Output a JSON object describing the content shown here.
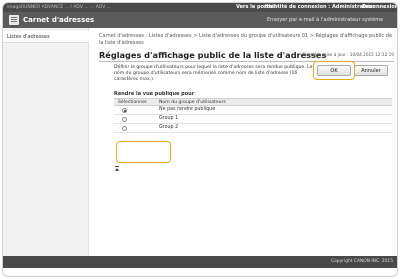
{
  "topbar": {
    "device": "imageRUNNER ADVANCE ... / ADV ...   ... ADV ...",
    "portal_link": "Vers le portail",
    "login_text": "Identité de connexion : Administrateur",
    "logout_link": "Déconnexion"
  },
  "titlebar": {
    "title": "Carnet d'adresses",
    "send_link": "Envoyer par e-mail à l'administrateur système"
  },
  "sidebar": {
    "items": [
      {
        "label": "Listes d'adresses"
      }
    ]
  },
  "main": {
    "breadcrumb": "Carnet d'adresses : Listes d'adresses > Liste d'adresses du groupe d'utilisateurs 01 > Réglages d'affichage public de la liste d'adresses",
    "title": "Réglages d'affichage public de la liste d'adresses",
    "updated": "Dernière mise à jour : 10/04 2015 12:12:19",
    "description": "Définir le groupe d'utilisateurs pour lequel la liste d'adresses sera rendue publique. Le nom du groupe d'utilisateurs sera mémorisé comme nom de liste d'adresse (16 caractères max.).",
    "ok_label": "OK",
    "cancel_label": "Annuler",
    "section_title": "Rendre la vue publique pour",
    "table": {
      "headers": [
        "Sélectionner",
        "Nom du groupe d'utilisateurs"
      ],
      "rows": [
        {
          "label": "Ne pas rendre publique",
          "selected": true
        },
        {
          "label": "Group 1",
          "selected": false
        },
        {
          "label": "Group 2",
          "selected": false
        }
      ]
    }
  },
  "footer": {
    "copyright": "Copyright CANON INC. 2015"
  },
  "colors": {
    "highlight": "#f0a81a",
    "topbar": "#4a4a4a",
    "titlebar": "#5b5b5b"
  }
}
